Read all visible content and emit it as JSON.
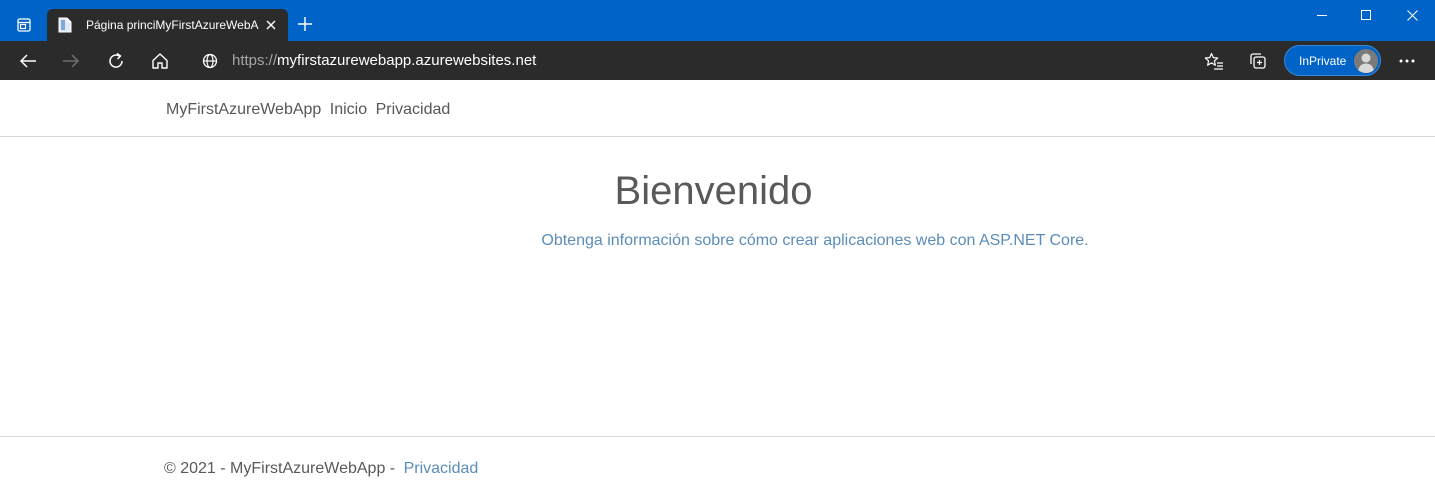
{
  "browser": {
    "tab": {
      "title": "Página princiMyFirstAzureWebA"
    },
    "address": {
      "scheme": "https://",
      "host": "myfirstazurewebapp.azurewebsites.net"
    },
    "inprivate_label": "InPrivate",
    "colors": {
      "titlebar": "#0063c8",
      "toolbar": "#2b2b2b",
      "inprivate": "#0063c8"
    },
    "icons": {
      "tab_actions": "tab-actions-icon",
      "favicon": "page-icon",
      "close": "close-icon",
      "new_tab": "plus-icon",
      "minimize": "minimize-icon",
      "maximize": "maximize-icon",
      "window_close": "close-icon",
      "back": "arrow-left-icon",
      "forward": "arrow-right-icon",
      "refresh": "refresh-icon",
      "home": "home-icon",
      "site_info": "globe-icon",
      "favorites": "star-list-icon",
      "collections": "collections-icon",
      "menu": "more-icon"
    }
  },
  "page": {
    "header": {
      "brand": "MyFirstAzureWebApp",
      "nav": [
        "Inicio",
        "Privacidad"
      ]
    },
    "main": {
      "heading": "Bienvenido",
      "lead_prefix": "",
      "lead_link": "Obtenga información sobre cómo crear aplicaciones web con ASP.NET Core."
    },
    "footer": {
      "copyright": "© 2021 - MyFirstAzureWebApp -",
      "privacy_link": "Privacidad"
    },
    "colors": {
      "text": "#595959",
      "link": "#5b8db8"
    }
  }
}
